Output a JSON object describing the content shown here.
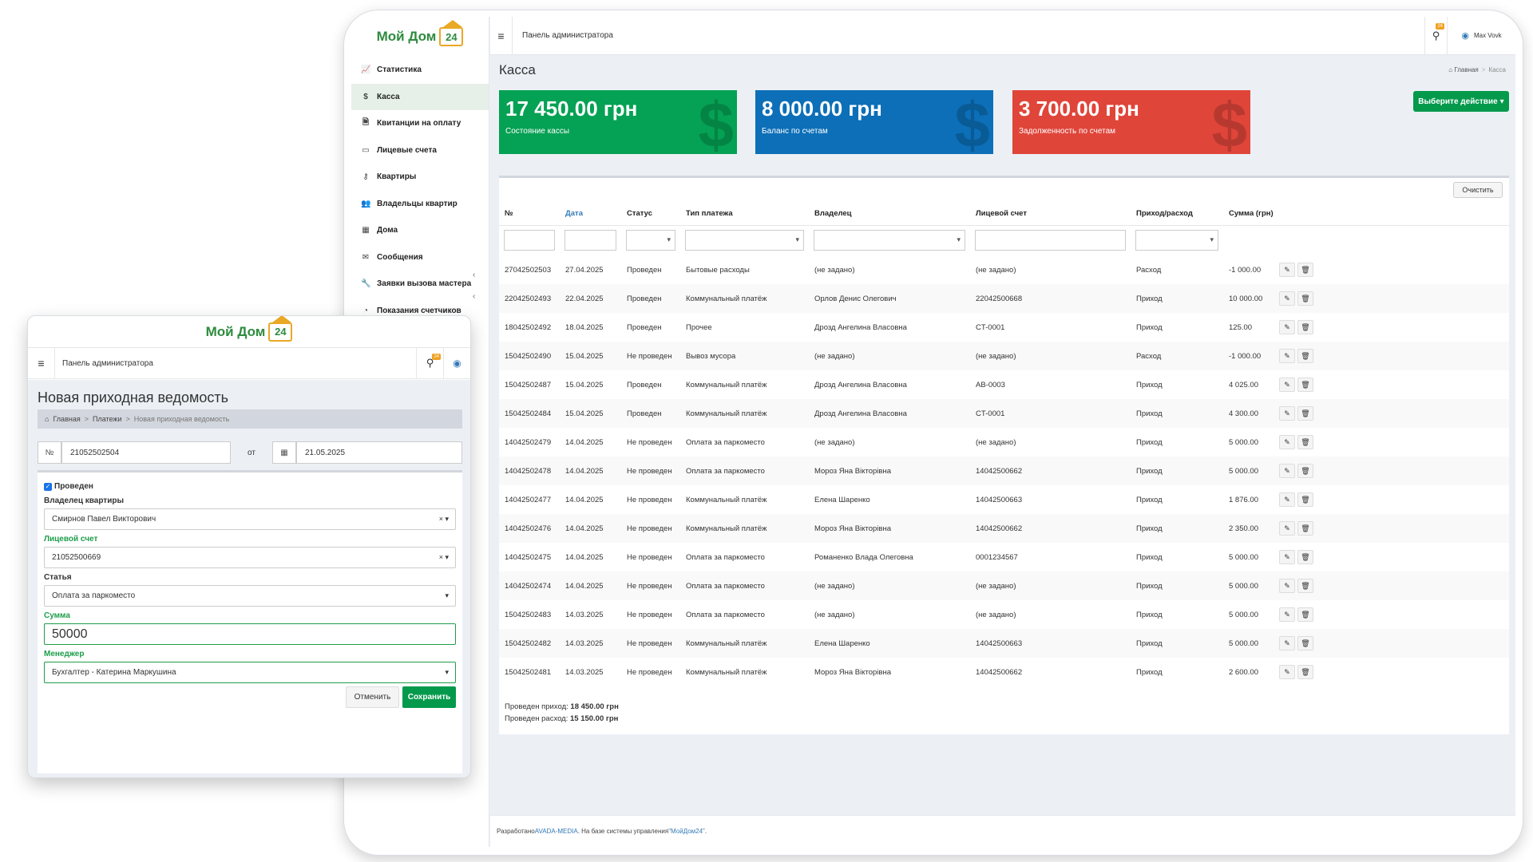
{
  "brand": {
    "name": "Мой Дом",
    "badge": "24"
  },
  "topbar": {
    "title": "Панель администратора",
    "notif_badge": "24",
    "user": "Max Vovk"
  },
  "sidebar": {
    "items": [
      {
        "icon": "chart-icon",
        "glyph": "📈",
        "label": "Статистика"
      },
      {
        "icon": "dollar-icon",
        "glyph": "$",
        "label": "Касса"
      },
      {
        "icon": "receipt-icon",
        "glyph": "🗎",
        "label": "Квитанции на оплату"
      },
      {
        "icon": "card-icon",
        "glyph": "▭",
        "label": "Лицевые счета"
      },
      {
        "icon": "key-icon",
        "glyph": "⚷",
        "label": "Квартиры"
      },
      {
        "icon": "users-icon",
        "glyph": "👥",
        "label": "Владельцы квартир"
      },
      {
        "icon": "building-icon",
        "glyph": "▦",
        "label": "Дома"
      },
      {
        "icon": "envelope-icon",
        "glyph": "✉",
        "label": "Сообщения"
      },
      {
        "icon": "wrench-icon",
        "glyph": "🔧",
        "label": "Заявки вызова мастера"
      },
      {
        "icon": "gauge-icon",
        "glyph": "◔",
        "label": "Показания счетчиков"
      }
    ]
  },
  "page": {
    "title": "Касса",
    "crumb_home": "Главная",
    "crumb_current": "Касса"
  },
  "kpis": [
    {
      "value": "17 450.00 грн",
      "label": "Состояние кассы",
      "color": "#05a154"
    },
    {
      "value": "8 000.00 грн",
      "label": "Баланс по счетам",
      "color": "#0c6fb8"
    },
    {
      "value": "3 700.00 грн",
      "label": "Задолженность по счетам",
      "color": "#e0453a"
    }
  ],
  "actions": {
    "dropdown": "Выберите действие",
    "clear": "Очистить"
  },
  "table": {
    "headers": [
      "№",
      "Дата",
      "Статус",
      "Тип платежа",
      "Владелец",
      "Лицевой счет",
      "Приход/расход",
      "Сумма (грн)"
    ],
    "rows": [
      [
        "27042502503",
        "27.04.2025",
        "Проведен",
        "Бытовые расходы",
        "(не задано)",
        "(не задано)",
        "Расход",
        "-1 000.00"
      ],
      [
        "22042502493",
        "22.04.2025",
        "Проведен",
        "Коммунальный платёж",
        "Орлов Денис Олегович",
        "22042500668",
        "Приход",
        "10 000.00"
      ],
      [
        "18042502492",
        "18.04.2025",
        "Проведен",
        "Прочее",
        "Дрозд Ангелина Власовна",
        "CT-0001",
        "Приход",
        "125.00"
      ],
      [
        "15042502490",
        "15.04.2025",
        "Не проведен",
        "Вывоз мусора",
        "(не задано)",
        "(не задано)",
        "Расход",
        "-1 000.00"
      ],
      [
        "15042502487",
        "15.04.2025",
        "Проведен",
        "Коммунальный платёж",
        "Дрозд Ангелина Власовна",
        "AB-0003",
        "Приход",
        "4 025.00"
      ],
      [
        "15042502484",
        "15.04.2025",
        "Проведен",
        "Коммунальный платёж",
        "Дрозд Ангелина Власовна",
        "CT-0001",
        "Приход",
        "4 300.00"
      ],
      [
        "14042502479",
        "14.04.2025",
        "Не проведен",
        "Оплата за паркоместо",
        "(не задано)",
        "(не задано)",
        "Приход",
        "5 000.00"
      ],
      [
        "14042502478",
        "14.04.2025",
        "Не проведен",
        "Оплата за паркоместо",
        "Мороз Яна Вікторівна",
        "14042500662",
        "Приход",
        "5 000.00"
      ],
      [
        "14042502477",
        "14.04.2025",
        "Не проведен",
        "Коммунальный платёж",
        "Елена Шаренко",
        "14042500663",
        "Приход",
        "1 876.00"
      ],
      [
        "14042502476",
        "14.04.2025",
        "Не проведен",
        "Коммунальный платёж",
        "Мороз Яна Вікторівна",
        "14042500662",
        "Приход",
        "2 350.00"
      ],
      [
        "14042502475",
        "14.04.2025",
        "Не проведен",
        "Оплата за паркоместо",
        "Романенко Влада Олеговна",
        "0001234567",
        "Приход",
        "5 000.00"
      ],
      [
        "14042502474",
        "14.04.2025",
        "Не проведен",
        "Оплата за паркоместо",
        "(не задано)",
        "(не задано)",
        "Приход",
        "5 000.00"
      ],
      [
        "15042502483",
        "14.03.2025",
        "Не проведен",
        "Оплата за паркоместо",
        "(не задано)",
        "(не задано)",
        "Приход",
        "5 000.00"
      ],
      [
        "15042502482",
        "14.03.2025",
        "Не проведен",
        "Коммунальный платёж",
        "Елена Шаренко",
        "14042500663",
        "Приход",
        "5 000.00"
      ],
      [
        "15042502481",
        "14.03.2025",
        "Не проведен",
        "Коммунальный платёж",
        "Мороз Яна Вікторівна",
        "14042500662",
        "Приход",
        "2 600.00"
      ]
    ]
  },
  "totals": {
    "income_label": "Проведен приход:",
    "income_value": "18 450.00 грн",
    "expense_label": "Проведен расход:",
    "expense_value": "15 150.00 грн"
  },
  "footer": {
    "prefix": "Разработано ",
    "company": "AVADA-MEDIA",
    "middle": ". На базе системы управления ",
    "product": "\"МойДом24\"",
    "suffix": "."
  },
  "card": {
    "title": "Новая приходная ведомость",
    "crumbs": [
      "Главная",
      "Платежи",
      "Новая приходная ведомость"
    ],
    "number_addon": "№",
    "number": "21052502504",
    "from_label": "от",
    "date": "21.05.2025",
    "posted_label": "Проведен",
    "owner_label": "Владелец квартиры",
    "owner_value": "Смирнов Павел Викторович",
    "account_label": "Лицевой счет",
    "account_value": "21052500669",
    "article_label": "Статья",
    "article_value": "Оплата за паркоместо",
    "amount_label": "Сумма",
    "amount_value": "50000",
    "manager_label": "Менеджер",
    "manager_value": "Бухгалтер - Катерина Маркушина",
    "cancel": "Отменить",
    "save": "Сохранить"
  }
}
